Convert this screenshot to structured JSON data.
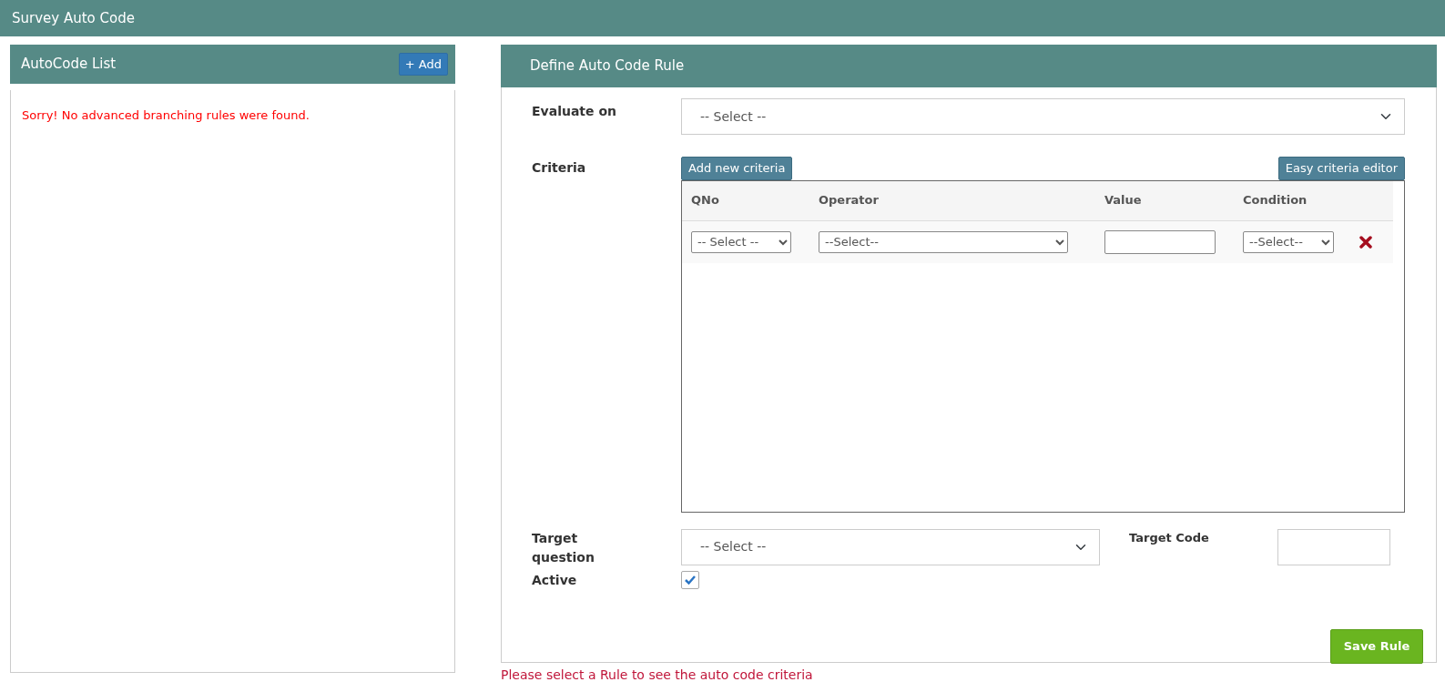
{
  "window": {
    "title": "Survey Auto Code"
  },
  "autocode_list": {
    "title": "AutoCode List",
    "add_button": "+ Add",
    "empty_message": "Sorry! No advanced branching rules were found."
  },
  "rule": {
    "title": "Define Auto Code Rule",
    "evaluate_on": {
      "label": "Evaluate on",
      "value": "-- Select --"
    },
    "criteria": {
      "label": "Criteria",
      "add_button": "Add new criteria",
      "editor_button": "Easy criteria editor",
      "columns": [
        "QNo",
        "Operator",
        "Value",
        "Condition"
      ],
      "rows": [
        {
          "qno": "-- Select --",
          "operator": "--Select--",
          "condition": "--Select--"
        }
      ]
    },
    "target_question": {
      "label": "Target question",
      "value": "-- Select --"
    },
    "target_code": {
      "label": "Target Code"
    },
    "active": {
      "label": "Active",
      "checked": true
    },
    "save_button": "Save Rule"
  },
  "status_message": "Please select a Rule to see the auto code criteria"
}
